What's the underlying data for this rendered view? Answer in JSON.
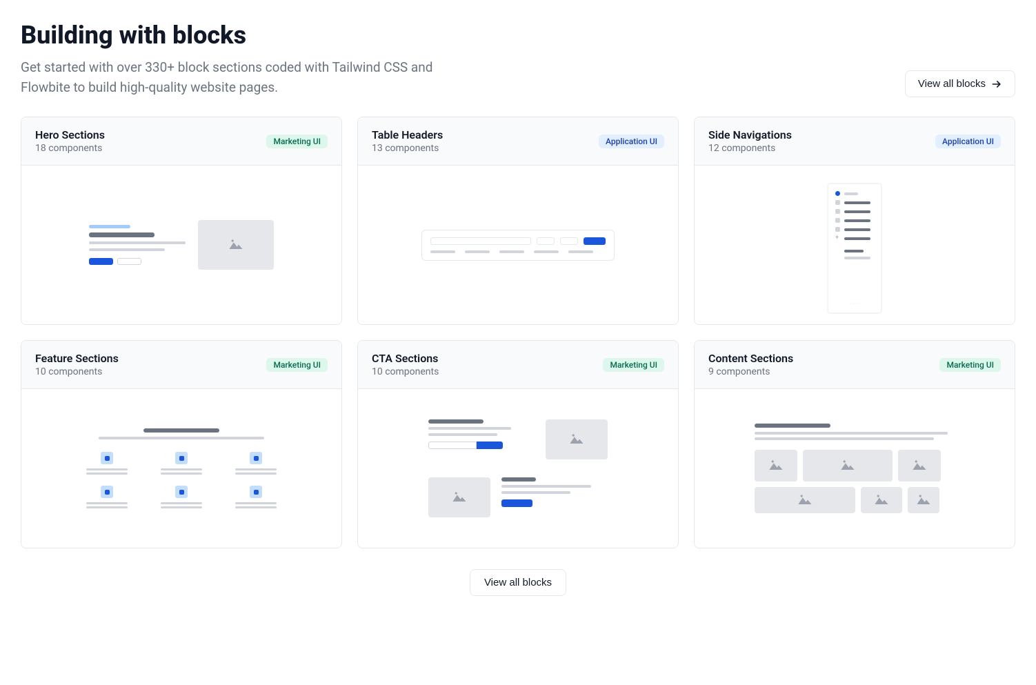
{
  "header": {
    "title": "Building with blocks",
    "subtitle": "Get started with over 330+ block sections coded with Tailwind CSS and Flowbite to build high-quality website pages.",
    "view_all": "View all blocks"
  },
  "badges": {
    "marketing": "Marketing UI",
    "application": "Application UI"
  },
  "cards": [
    {
      "title": "Hero Sections",
      "sub": "18 components",
      "badge": "marketing"
    },
    {
      "title": "Table Headers",
      "sub": "13 components",
      "badge": "application"
    },
    {
      "title": "Side Navigations",
      "sub": "12 components",
      "badge": "application"
    },
    {
      "title": "Feature Sections",
      "sub": "10 components",
      "badge": "marketing"
    },
    {
      "title": "CTA Sections",
      "sub": "10 components",
      "badge": "marketing"
    },
    {
      "title": "Content Sections",
      "sub": "9 components",
      "badge": "marketing"
    }
  ],
  "footer": {
    "view_all": "View all blocks"
  }
}
